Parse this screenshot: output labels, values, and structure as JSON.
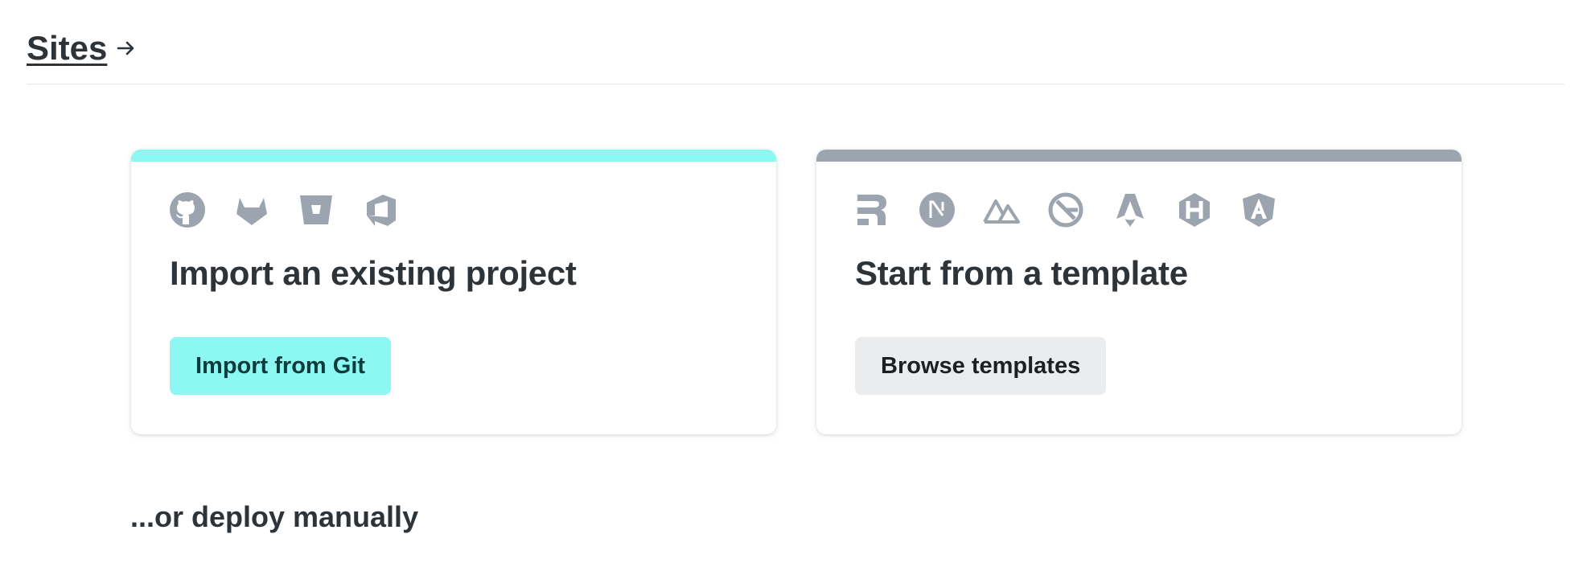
{
  "header": {
    "title": "Sites",
    "arrow": "→"
  },
  "cards": {
    "import": {
      "icons": [
        "github-icon",
        "gitlab-icon",
        "bitbucket-icon",
        "azure-devops-icon"
      ],
      "title": "Import an existing project",
      "button": "Import from Git",
      "accent_color": "#8df7f1"
    },
    "template": {
      "icons": [
        "remix-icon",
        "nextjs-icon",
        "nuxt-icon",
        "gatsby-icon",
        "astro-icon",
        "hugo-icon",
        "angular-icon"
      ],
      "title": "Start from a template",
      "button": "Browse templates",
      "accent_color": "#9ca5af"
    }
  },
  "footer": {
    "manual_deploy": "...or deploy manually"
  },
  "colors": {
    "text": "#2e3338",
    "icon": "#9ca5af",
    "primary_button": "#8df7f1",
    "secondary_button": "#ebeced"
  }
}
